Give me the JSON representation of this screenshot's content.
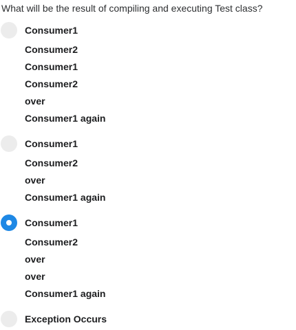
{
  "question": "What will be the result of compiling and executing Test class?",
  "options": [
    {
      "selected": false,
      "lines": [
        "Consumer1",
        "Consumer2",
        "Consumer1",
        "Consumer2",
        "over",
        "Consumer1 again"
      ]
    },
    {
      "selected": false,
      "lines": [
        "Consumer1",
        "Consumer2",
        "over",
        "Consumer1 again"
      ]
    },
    {
      "selected": true,
      "lines": [
        "Consumer1",
        "Consumer2",
        "over",
        "over",
        "Consumer1 again"
      ]
    },
    {
      "selected": false,
      "lines": [
        "Exception Occurs"
      ]
    }
  ],
  "colors": {
    "radio_unselected": "#ececec",
    "radio_selected": "#1e88e5"
  }
}
